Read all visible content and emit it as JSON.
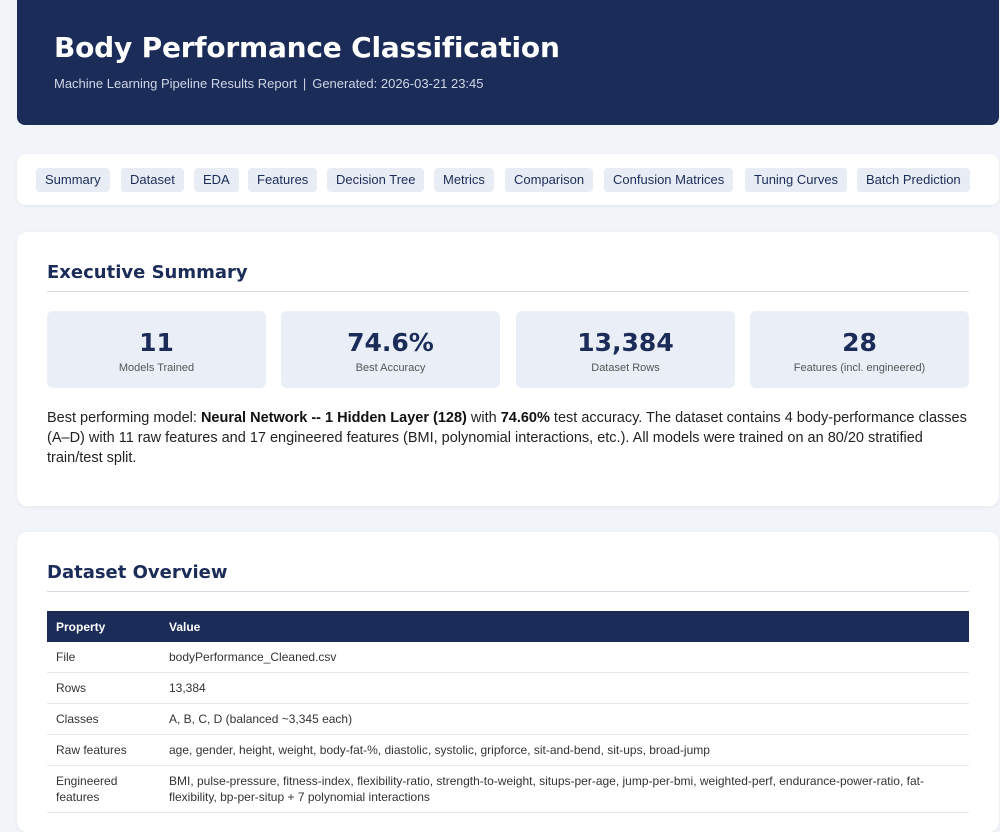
{
  "header": {
    "title": "Body Performance Classification",
    "subtitle": "Machine Learning Pipeline Results Report",
    "separator": "|",
    "generated": "Generated: 2026-03-21 23:45"
  },
  "nav": {
    "tabs": [
      "Summary",
      "Dataset",
      "EDA",
      "Features",
      "Decision Tree",
      "Metrics",
      "Comparison",
      "Confusion Matrices",
      "Tuning Curves",
      "Batch Prediction"
    ]
  },
  "summary": {
    "title": "Executive Summary",
    "stats": [
      {
        "value": "11",
        "label": "Models Trained"
      },
      {
        "value": "74.6%",
        "label": "Best Accuracy"
      },
      {
        "value": "13,384",
        "label": "Dataset Rows"
      },
      {
        "value": "28",
        "label": "Features (incl. engineered)"
      }
    ],
    "text_prefix": "Best performing model: ",
    "best_model": "Neural Network -- 1 Hidden Layer (128)",
    "text_with": " with ",
    "best_accuracy": "74.60%",
    "text_rest": " test accuracy. The dataset contains 4 body-performance classes (A–D) with 11 raw features and 17 engineered features (BMI, polynomial interactions, etc.). All models were trained on an 80/20 stratified train/test split."
  },
  "dataset": {
    "title": "Dataset Overview",
    "columns": [
      "Property",
      "Value"
    ],
    "rows": [
      [
        "File",
        "bodyPerformance_Cleaned.csv"
      ],
      [
        "Rows",
        "13,384"
      ],
      [
        "Classes",
        "A, B, C, D (balanced ~3,345 each)"
      ],
      [
        "Raw features",
        "age, gender, height, weight, body-fat-%, diastolic, systolic, gripforce, sit-and-bend, sit-ups, broad-jump"
      ],
      [
        "Engineered features",
        "BMI, pulse-pressure, fitness-index, flexibility-ratio, strength-to-weight, situps-per-age, jump-per-bmi, weighted-perf, endurance-power-ratio, fat-flexibility, bp-per-situp + 7 polynomial interactions"
      ]
    ]
  },
  "colors": {
    "primary": "#1b2c59",
    "background": "#f1f4f8",
    "stat_card": "#e9eef7",
    "tab_bg": "#e7ecf5"
  }
}
